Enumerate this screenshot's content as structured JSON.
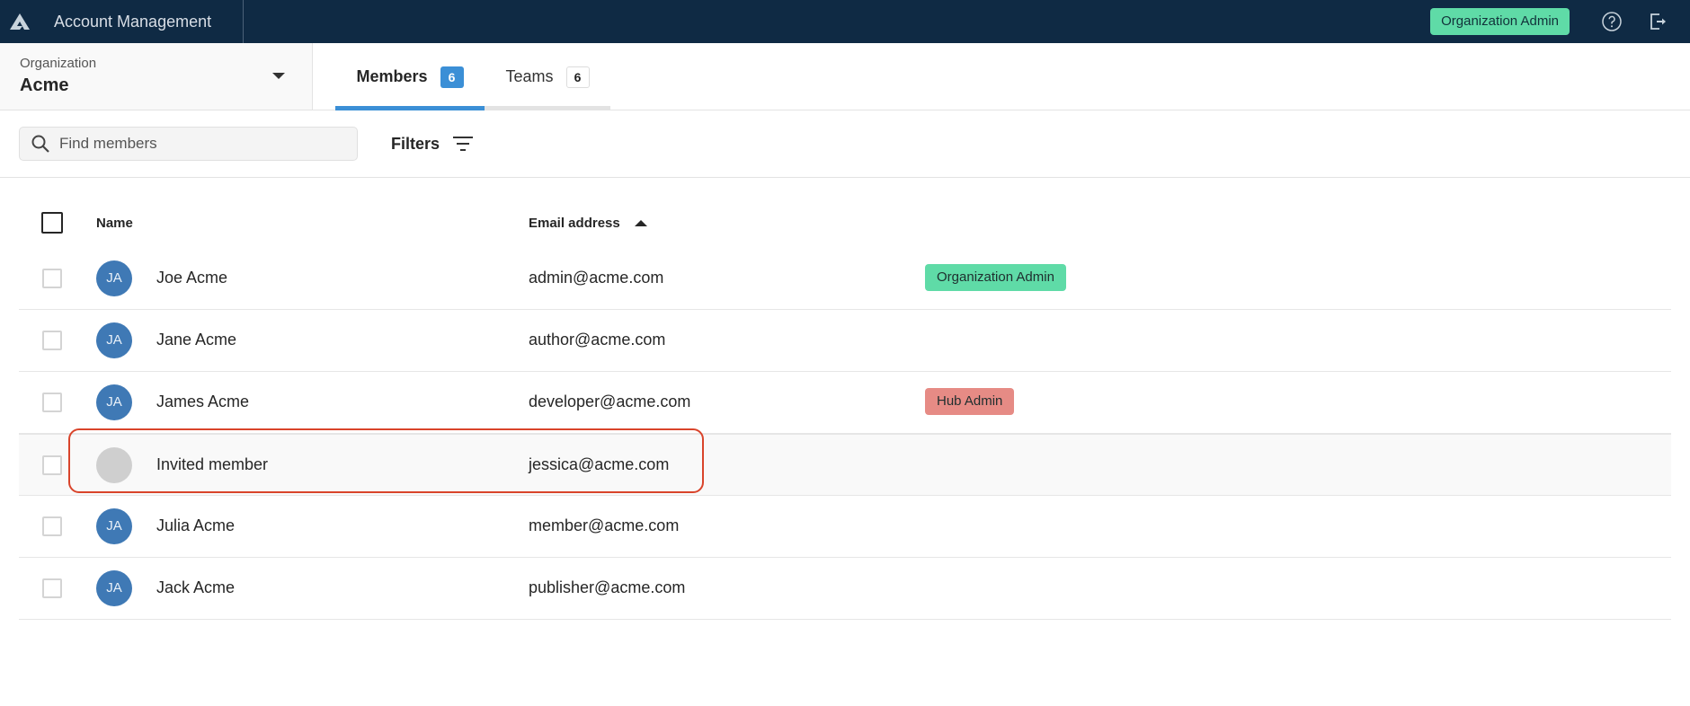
{
  "app": {
    "title": "Account Management",
    "user_role_chip": "Organization Admin",
    "help_icon": "question-circle-icon",
    "logout_icon": "logout-icon",
    "colors": {
      "topbar": "#0f2a44",
      "accent": "#3b8fd6",
      "org_admin": "#5fdba7",
      "hub_admin": "#e68b85",
      "highlight": "#d9442b"
    }
  },
  "org": {
    "label": "Organization",
    "value": "Acme"
  },
  "tabs": [
    {
      "label": "Members",
      "count": "6",
      "active": true
    },
    {
      "label": "Teams",
      "count": "6",
      "active": false
    }
  ],
  "toolbar": {
    "search_placeholder": "Find members",
    "search_value": "",
    "filters_label": "Filters"
  },
  "table": {
    "columns": {
      "name": "Name",
      "email": "Email address",
      "email_sort": "ascending"
    },
    "rows": [
      {
        "initials": "JA",
        "name": "Joe Acme",
        "email": "admin@acme.com",
        "role": "Organization Admin",
        "role_color": "#5fdba7"
      },
      {
        "initials": "JA",
        "name": "Jane Acme",
        "email": "author@acme.com",
        "role": "",
        "role_color": ""
      },
      {
        "initials": "JA",
        "name": "James Acme",
        "email": "developer@acme.com",
        "role": "Hub Admin",
        "role_color": "#e68b85"
      },
      {
        "initials": "",
        "name": "Invited member",
        "email": "jessica@acme.com",
        "role": "",
        "role_color": "",
        "invited": true
      },
      {
        "initials": "JA",
        "name": "Julia Acme",
        "email": "member@acme.com",
        "role": "",
        "role_color": ""
      },
      {
        "initials": "JA",
        "name": "Jack Acme",
        "email": "publisher@acme.com",
        "role": "",
        "role_color": ""
      }
    ]
  }
}
